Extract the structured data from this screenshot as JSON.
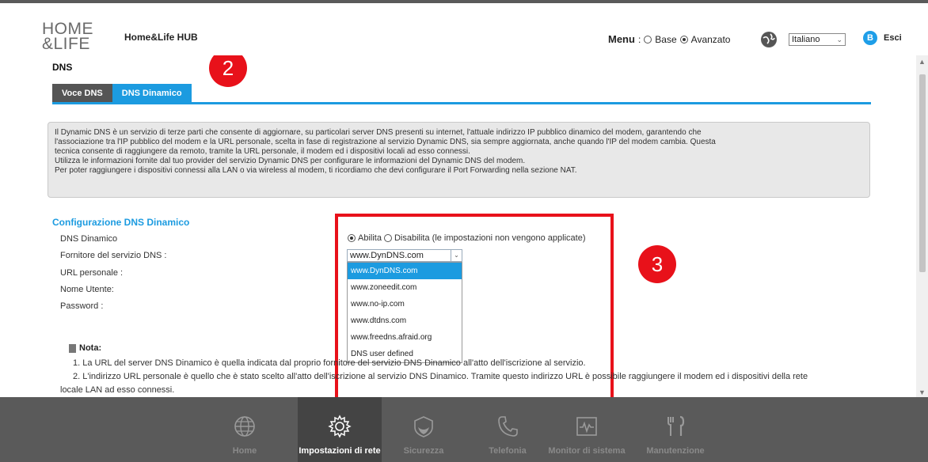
{
  "header": {
    "logo_line1": "HOME",
    "logo_line2": "&LIFE",
    "hub_title": "Home&Life HUB",
    "menu_label": "Menu",
    "menu_sep": ":",
    "menu_base": "Base",
    "menu_advanced": "Avanzato",
    "menu_selected": "Avanzato",
    "language": "Italiano",
    "exit": "Esci"
  },
  "page": {
    "title": "DNS",
    "tabs": [
      {
        "label": "Voce DNS",
        "active": false
      },
      {
        "label": "DNS Dinamico",
        "active": true
      }
    ],
    "badge_a": "2",
    "badge_b": "3",
    "info_lines": [
      "Il Dynamic DNS è un servizio di terze parti che consente di aggiornare, su particolari server DNS presenti su internet, l'attuale indirizzo IP pubblico dinamico del modem, garantendo che",
      "l'associazione tra l'IP pubblico del modem e la URL personale, scelta in fase di registrazione al servizio Dynamic DNS, sia sempre aggiornata, anche quando l'IP del modem cambia. Questa",
      "tecnica consente di raggiungere da remoto, tramite la URL personale, il modem ed i dispositivi locali ad esso connessi.",
      "Utilizza le informazioni fornite dal tuo provider del servizio Dynamic DNS per configurare le informazioni del Dynamic DNS del modem.",
      "Per poter raggiungere i dispositivi connessi alla LAN o via wireless al modem, ti ricordiamo che devi configurare il Port Forwarding nella sezione NAT."
    ],
    "section_title": "Configurazione DNS Dinamico",
    "labels": {
      "ddns": "DNS Dinamico",
      "provider": "Fornitore del servizio DNS :",
      "url": "URL personale :",
      "username": "Nome Utente:",
      "password": "Password :"
    },
    "enable": "Abilita",
    "disable": "Disabilita (le impostazioni non vengono applicate)",
    "enabled": true,
    "provider_selected": "www.DynDNS.com",
    "provider_options": [
      "www.DynDNS.com",
      "www.zoneedit.com",
      "www.no-ip.com",
      "www.dtdns.com",
      "www.freedns.afraid.org",
      "DNS user defined"
    ],
    "note_title": "Nota:",
    "note_1": "1. La URL del server DNS Dinamico è quella indicata dal proprio fornitore del servizio DNS Dinamico all'atto dell'iscrizione al servizio.",
    "note_2": "2. L'indirizzo URL personale è quello che è stato scelto all'atto dell'iscrizione al servizio DNS Dinamico. Tramite questo indirizzo URL è possibile raggiungere il modem ed i dispositivi della rete",
    "note_2b": "locale LAN ad esso connessi."
  },
  "footer": {
    "items": [
      {
        "label": "Home",
        "icon": "globe-icon",
        "active": false
      },
      {
        "label": "Impostazioni di rete",
        "icon": "gear-icon",
        "active": true
      },
      {
        "label": "Sicurezza",
        "icon": "shield-icon",
        "active": false
      },
      {
        "label": "Telefonia",
        "icon": "phone-icon",
        "active": false
      },
      {
        "label": "Monitor di sistema",
        "icon": "monitor-icon",
        "active": false
      },
      {
        "label": "Manutenzione",
        "icon": "tools-icon",
        "active": false
      }
    ]
  },
  "colors": {
    "accent": "#1c9be0",
    "annotation_red": "#e8111a",
    "footer_bg": "#5a5a5a"
  }
}
